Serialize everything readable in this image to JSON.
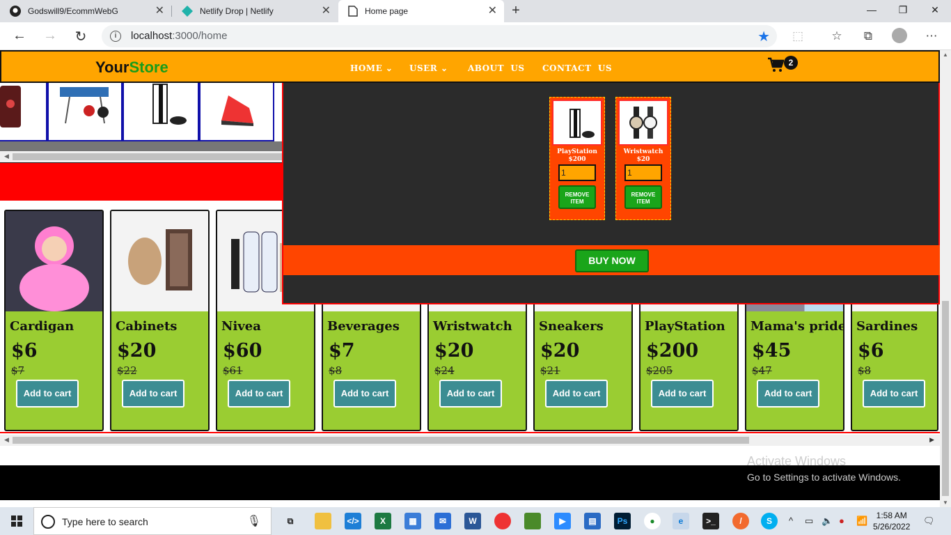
{
  "browser": {
    "tabs": [
      {
        "title": "Godswill9/EcommWebG",
        "icon": "github-icon"
      },
      {
        "title": "Netlify Drop | Netlify",
        "icon": "netlify-icon"
      },
      {
        "title": "Home page",
        "icon": "page-icon",
        "active": true
      }
    ],
    "url_host": "localhost",
    "url_rest": ":3000/home"
  },
  "site": {
    "logo_your": "Your",
    "logo_store": "Store",
    "menu": [
      {
        "label": "HOME",
        "dropdown": true
      },
      {
        "label": "USER",
        "dropdown": true
      },
      {
        "label": "ABOUT  US",
        "dropdown": false
      },
      {
        "label": "CONTACT  US",
        "dropdown": false
      }
    ],
    "cart_count": "2",
    "accent_orange": "#ffa500",
    "accent_green": "#9acd32"
  },
  "cart_panel": {
    "items": [
      {
        "name": "PlayStation",
        "price": "$200",
        "qty": "1",
        "remove_label_1": "REMOVE",
        "remove_label_2": "ITEM"
      },
      {
        "name": "Wristwatch",
        "price": "$20",
        "qty": "1",
        "remove_label_1": "REMOVE",
        "remove_label_2": "ITEM"
      }
    ],
    "buy_label": "BUY NOW"
  },
  "products": [
    {
      "name": "Cardigan",
      "price": "$6",
      "old_price": "$7",
      "button": "Add to cart"
    },
    {
      "name": "Cabinets",
      "price": "$20",
      "old_price": "$22",
      "button": "Add to cart"
    },
    {
      "name": "Nivea",
      "price": "$60",
      "old_price": "$61",
      "button": "Add to cart"
    },
    {
      "name": "Beverages",
      "price": "$7",
      "old_price": "$8",
      "button": "Add to cart"
    },
    {
      "name": "Wristwatch",
      "price": "$20",
      "old_price": "$24",
      "button": "Add to cart"
    },
    {
      "name": "Sneakers",
      "price": "$20",
      "old_price": "$21",
      "button": "Add to cart"
    },
    {
      "name": "PlayStation",
      "price": "$200",
      "old_price": "$205",
      "button": "Add to cart"
    },
    {
      "name": "Mama's pride",
      "price": "$45",
      "old_price": "$47",
      "button": "Add to cart"
    },
    {
      "name": "Sardines",
      "price": "$6",
      "old_price": "$8",
      "button": "Add to cart"
    }
  ],
  "watermark": {
    "line1": "Activate Windows",
    "line2": "Go to Settings to activate Windows."
  },
  "taskbar": {
    "search_placeholder": "Type here to search",
    "time": "1:58 AM",
    "date": "5/26/2022"
  }
}
